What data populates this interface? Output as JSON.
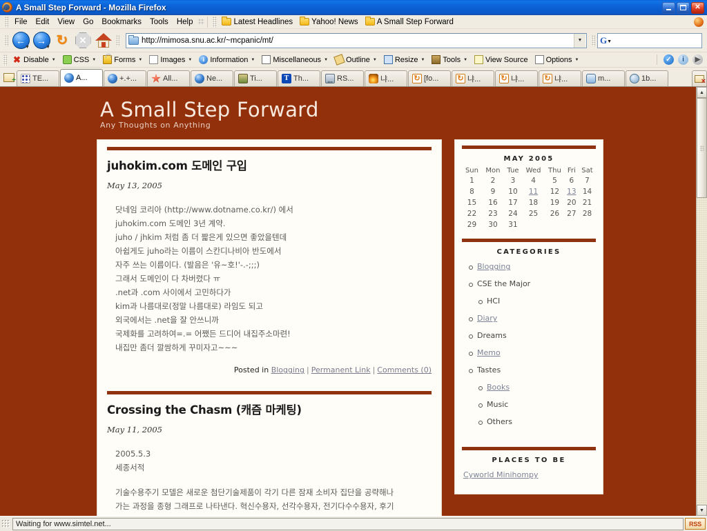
{
  "window": {
    "title": "A Small Step Forward - Mozilla Firefox",
    "minimize": "_",
    "maximize": "□",
    "close": "✕"
  },
  "menu": {
    "items": [
      "File",
      "Edit",
      "View",
      "Go",
      "Bookmarks",
      "Tools",
      "Help"
    ]
  },
  "bookmarks_bar": {
    "items": [
      "Latest Headlines",
      "Yahoo! News",
      "A Small Step Forward"
    ]
  },
  "navbar": {
    "back": "←",
    "forward": "→",
    "reload": "↻",
    "stop": "✕",
    "home": "home-icon",
    "url": "http://mimosa.snu.ac.kr/~mcpanic/mt/",
    "url_dropdown": "▼",
    "search_engine": "G",
    "search_value": "",
    "search_placeholder": ""
  },
  "devbar": {
    "items": [
      {
        "label": "Disable",
        "icon": "x-icon",
        "caret": "▼"
      },
      {
        "label": "CSS",
        "icon": "puzzle-icon",
        "caret": "▼"
      },
      {
        "label": "Forms",
        "icon": "lock-icon",
        "caret": "▼"
      },
      {
        "label": "Images",
        "icon": "image-icon",
        "caret": "▼"
      },
      {
        "label": "Information",
        "icon": "info-icon",
        "caret": "▼"
      },
      {
        "label": "Miscellaneous",
        "icon": "list-icon",
        "caret": "▼"
      },
      {
        "label": "Outline",
        "icon": "pencil-icon",
        "caret": "▼"
      },
      {
        "label": "Resize",
        "icon": "window-icon",
        "caret": "▼"
      },
      {
        "label": "Tools",
        "icon": "toolbox-icon",
        "caret": "▼"
      },
      {
        "label": "View Source",
        "icon": "clipboard-icon",
        "caret": ""
      },
      {
        "label": "Options",
        "icon": "options-icon",
        "caret": "▼"
      }
    ],
    "right_icons": [
      "check-icon",
      "info-icon",
      "play-icon"
    ]
  },
  "tabs": {
    "new_tab_icon": "new-tab-icon",
    "close_tab_icon": "close-tab-icon",
    "items": [
      {
        "label": "TE...",
        "favicon": "dots",
        "active": false
      },
      {
        "label": "A...",
        "favicon": "ff",
        "active": true
      },
      {
        "label": "+.+...",
        "favicon": "ff",
        "active": false
      },
      {
        "label": "All...",
        "favicon": "red",
        "active": false
      },
      {
        "label": "Ne...",
        "favicon": "ff",
        "active": false
      },
      {
        "label": "Ti...",
        "favicon": "photo",
        "active": false
      },
      {
        "label": "Th...",
        "favicon": "blueT",
        "active": false
      },
      {
        "label": "RS...",
        "favicon": "zine",
        "active": false
      },
      {
        "label": "냐...",
        "favicon": "flame",
        "active": false
      },
      {
        "label": "[fo...",
        "favicon": "refresh",
        "active": false
      },
      {
        "label": "냐...",
        "favicon": "refresh",
        "active": false
      },
      {
        "label": "냐...",
        "favicon": "refresh",
        "active": false
      },
      {
        "label": "냐...",
        "favicon": "refresh",
        "active": false
      },
      {
        "label": "m...",
        "favicon": "win",
        "active": false
      },
      {
        "label": "1b...",
        "favicon": "globe",
        "active": false
      }
    ]
  },
  "blog": {
    "title": "A Small Step Forward",
    "subtitle": "Any Thoughts on Anything",
    "entries": [
      {
        "heading": "juhokim.com 도메인 구입",
        "date": "May 13, 2005",
        "lines": [
          "닷네임 코리아 (http://www.dotname.co.kr/) 에서",
          "juhokim.com 도메인 3년 계약.",
          "juho / jhkim 처럼 좀 더 짧은게 있으면 좋았을텐데",
          "아쉽게도 juho라는 이름이 스칸디나비아 반도에서",
          "자주 쓰는 이름이다. (발음은 '유~호!'-.-;;;)",
          "그래서 도메인이 다 차버렸다 ㅠ",
          ".net과 .com 사이에서 고민하다가",
          "kim과 나름대로(정말 나름대로) 라임도 되고",
          "외국에서는 .net을 잘 안쓰니까",
          "국제화를 고려하여=.= 어쨌든 드디어 내집주소마련!",
          "내집만 좀더 깔쌈하게 꾸미자고~~~"
        ],
        "posted_in_label": "Posted in",
        "category": "Blogging",
        "permalink": "Permanent Link",
        "comments": "Comments (0)",
        "separator": "|"
      },
      {
        "heading": "Crossing the Chasm (캐즘 마케팅)",
        "date": "May 11, 2005",
        "lines": [
          "2005.5.3",
          "세종서적",
          "",
          "기술수용주기 모델은 새로운 첨단기술제품이 각기 다른 잠재 소비자 집단을 공략해나",
          "가는 과정을 종형 그래프로 나타낸다. 혁신수용자, 선각수용자, 전기다수수용자, 후기"
        ]
      }
    ],
    "sidebar": {
      "calendar": {
        "caption": "MAY 2005",
        "weekdays": [
          "Sun",
          "Mon",
          "Tue",
          "Wed",
          "Thu",
          "Fri",
          "Sat"
        ],
        "weeks": [
          [
            "1",
            "2",
            "3",
            "4",
            "5",
            "6",
            "7"
          ],
          [
            "8",
            "9",
            "10",
            "11",
            "12",
            "13",
            "14"
          ],
          [
            "15",
            "16",
            "17",
            "18",
            "19",
            "20",
            "21"
          ],
          [
            "22",
            "23",
            "24",
            "25",
            "26",
            "27",
            "28"
          ],
          [
            "29",
            "30",
            "31",
            "",
            "",
            "",
            ""
          ]
        ],
        "linked_days": [
          "11",
          "13"
        ]
      },
      "categories_heading": "CATEGORIES",
      "categories": [
        {
          "label": "Blogging",
          "link": true,
          "children": []
        },
        {
          "label": "CSE the Major",
          "link": false,
          "children": [
            {
              "label": "HCI",
              "link": false
            }
          ]
        },
        {
          "label": "Diary",
          "link": true,
          "children": []
        },
        {
          "label": "Dreams",
          "link": false,
          "children": []
        },
        {
          "label": "Memo",
          "link": true,
          "children": []
        },
        {
          "label": "Tastes",
          "link": false,
          "children": [
            {
              "label": "Books",
              "link": true
            },
            {
              "label": "Music",
              "link": false
            },
            {
              "label": "Others",
              "link": false
            }
          ]
        }
      ],
      "places_heading": "PLACES TO BE",
      "places": [
        "Cyworld Minihompy"
      ]
    }
  },
  "statusbar": {
    "text": "Waiting for www.simtel.net...",
    "rss_label": "RSS"
  },
  "colors": {
    "page_background": "#93300c",
    "accent_rule": "#8f3210",
    "link": "#7c8398",
    "titlebar": "#0b62d6"
  }
}
